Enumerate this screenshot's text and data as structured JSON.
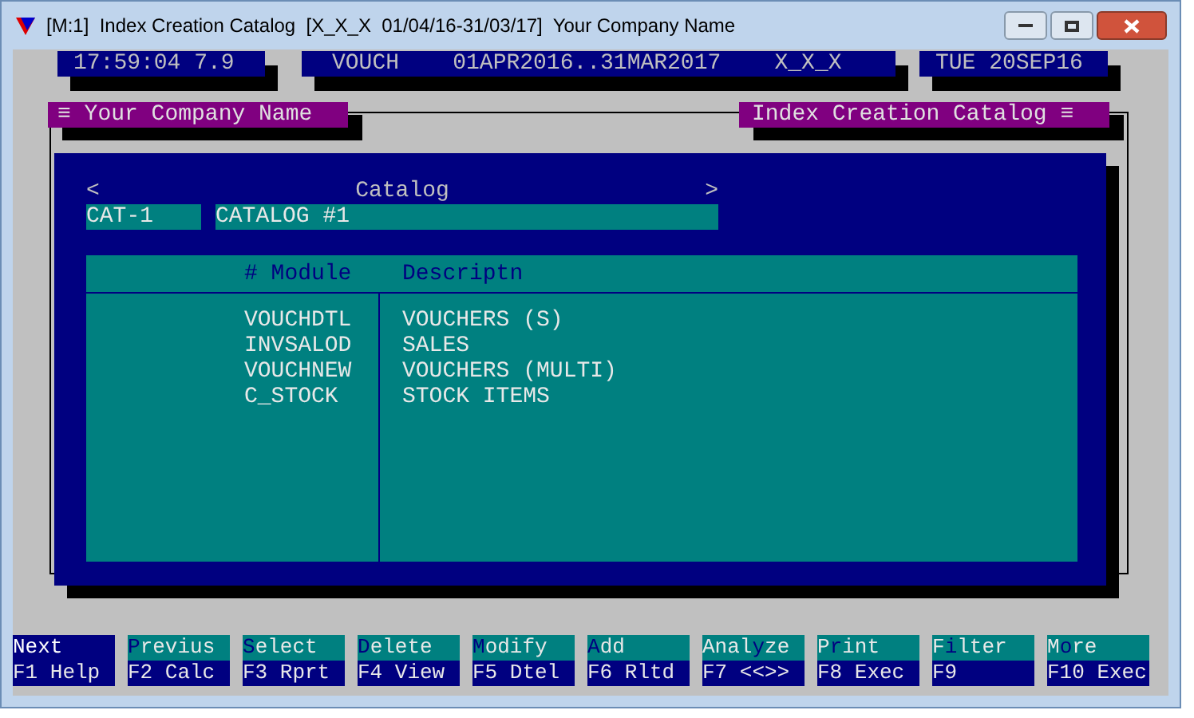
{
  "window": {
    "title": "[M:1]  Index Creation Catalog  [X_X_X  01/04/16-31/03/17]  Your Company Name"
  },
  "status_bar": [
    "17:59:04 7.9",
    "VOUCH    01APR2016..31MAR2017    X_X_X",
    "TUE 20SEP16"
  ],
  "header": {
    "left": "≡ Your Company Name",
    "right": "Index Creation Catalog ≡"
  },
  "catalog": {
    "prev": "<",
    "title": "Catalog",
    "next": ">",
    "code": "CAT-1",
    "name": "CATALOG #1"
  },
  "table": {
    "columns": [
      "# Module",
      "Descriptn"
    ],
    "rows": [
      {
        "module": "VOUCHDTL",
        "description": "VOUCHERS (S)"
      },
      {
        "module": "INVSALOD",
        "description": "SALES"
      },
      {
        "module": "VOUCHNEW",
        "description": "VOUCHERS (MULTI)"
      },
      {
        "module": "C_STOCK",
        "description": "STOCK ITEMS"
      }
    ]
  },
  "function_keys": [
    {
      "label": "Next",
      "key": "F1 Help",
      "selected": true
    },
    {
      "label": "**P**revius",
      "key": "F2 Calc",
      "selected": false
    },
    {
      "label": "**S**elect",
      "key": "F3 Rprt",
      "selected": false
    },
    {
      "label": "**D**elete",
      "key": "F4 View",
      "selected": false
    },
    {
      "label": "**M**odify",
      "key": "F5 Dtel",
      "selected": false
    },
    {
      "label": "**A**dd",
      "key": "F6 Rltd",
      "selected": false
    },
    {
      "label": "Anal**y**ze",
      "key": "F7 <<>>",
      "selected": false
    },
    {
      "label": "P**r**int",
      "key": "F8 Exec",
      "selected": false
    },
    {
      "label": "F**i**lter",
      "key": "F9",
      "selected": false
    },
    {
      "label": "M**o**re",
      "key": "F10 Exec",
      "selected": false
    }
  ]
}
